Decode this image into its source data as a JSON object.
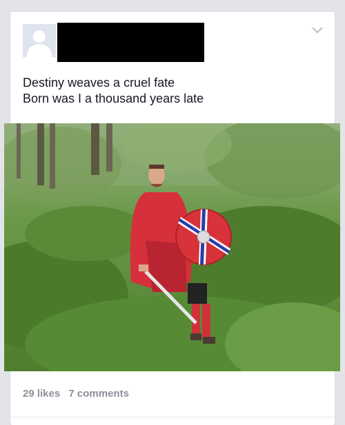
{
  "post": {
    "author_redacted": true,
    "text_lines": [
      "Destiny weaves a cruel fate",
      "Born was I a thousand years late"
    ],
    "likes_label": "29 likes",
    "comments_label": "7 comments",
    "photo_icon": "photo-of-man-in-red-cloak-with-shield-in-forest"
  },
  "colors": {
    "card_bg": "#ffffff",
    "page_bg": "#e3e4e8",
    "text": "#141823",
    "meta_text": "#8c8f98"
  }
}
